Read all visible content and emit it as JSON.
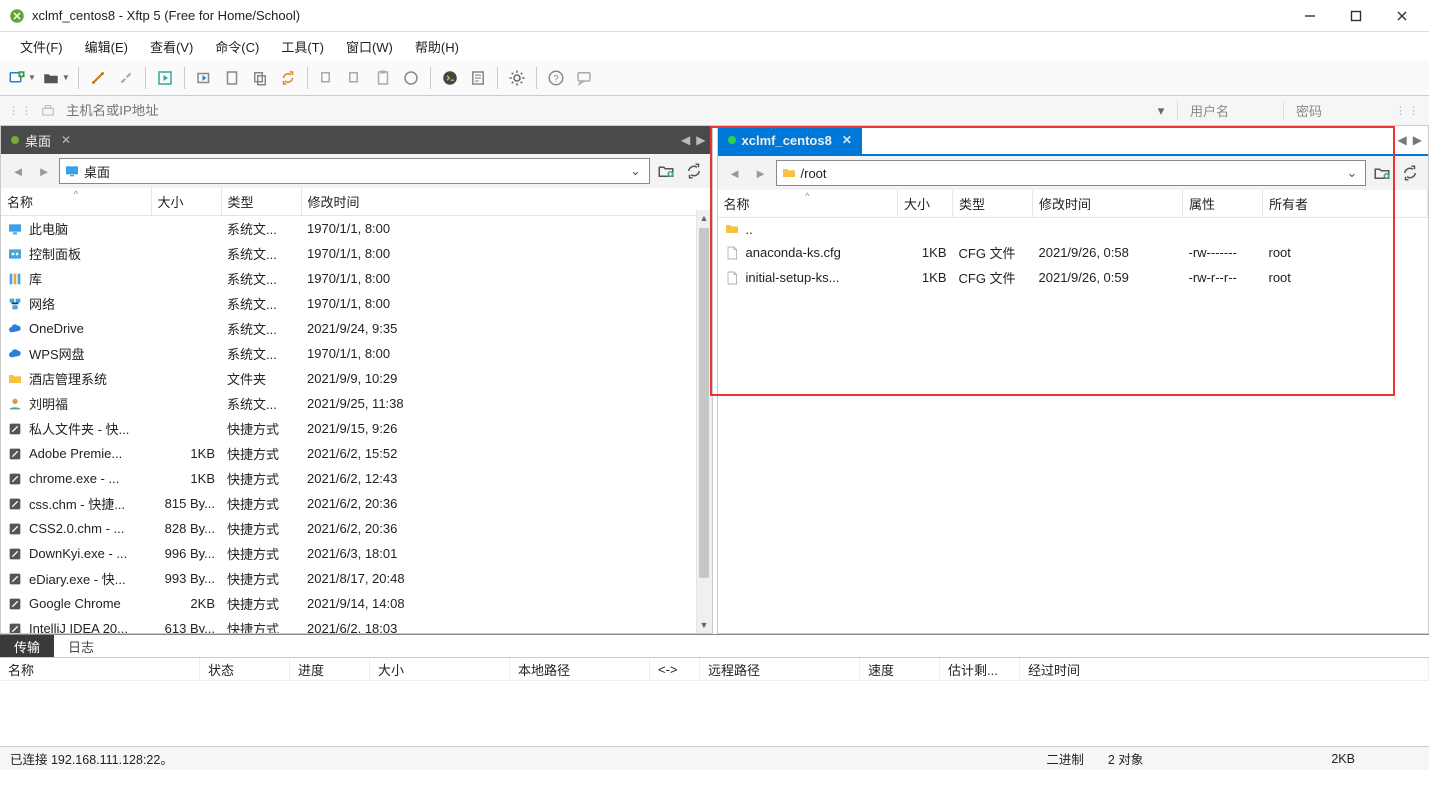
{
  "title": "xclmf_centos8   - Xftp 5 (Free for Home/School)",
  "menu": [
    "文件(F)",
    "编辑(E)",
    "查看(V)",
    "命令(C)",
    "工具(T)",
    "窗口(W)",
    "帮助(H)"
  ],
  "hostbar": {
    "placeholder": "主机名或IP地址",
    "user_ph": "用户名",
    "pass_ph": "密码"
  },
  "local": {
    "tab_label": "桌面",
    "path": "桌面",
    "cols": {
      "name": "名称",
      "size": "大小",
      "type": "类型",
      "mtime": "修改时间"
    },
    "rows": [
      {
        "icon": "pc",
        "name": "此电脑",
        "size": "",
        "type": "系统文...",
        "mtime": "1970/1/1, 8:00"
      },
      {
        "icon": "panel",
        "name": "控制面板",
        "size": "",
        "type": "系统文...",
        "mtime": "1970/1/1, 8:00"
      },
      {
        "icon": "lib",
        "name": "库",
        "size": "",
        "type": "系统文...",
        "mtime": "1970/1/1, 8:00"
      },
      {
        "icon": "net",
        "name": "网络",
        "size": "",
        "type": "系统文...",
        "mtime": "1970/1/1, 8:00"
      },
      {
        "icon": "cloud",
        "name": "OneDrive",
        "size": "",
        "type": "系统文...",
        "mtime": "2021/9/24, 9:35"
      },
      {
        "icon": "cloud",
        "name": "WPS网盘",
        "size": "",
        "type": "系统文...",
        "mtime": "1970/1/1, 8:00"
      },
      {
        "icon": "folder",
        "name": "酒店管理系统",
        "size": "",
        "type": "文件夹",
        "mtime": "2021/9/9, 10:29"
      },
      {
        "icon": "user",
        "name": "刘明福",
        "size": "",
        "type": "系统文...",
        "mtime": "2021/9/25, 11:38"
      },
      {
        "icon": "shortcut",
        "name": "私人文件夹 - 快...",
        "size": "",
        "type": "快捷方式",
        "mtime": "2021/9/15, 9:26"
      },
      {
        "icon": "app",
        "name": "Adobe Premie...",
        "size": "1KB",
        "type": "快捷方式",
        "mtime": "2021/6/2, 15:52"
      },
      {
        "icon": "app",
        "name": "chrome.exe - ...",
        "size": "1KB",
        "type": "快捷方式",
        "mtime": "2021/6/2, 12:43"
      },
      {
        "icon": "app",
        "name": "css.chm - 快捷...",
        "size": "815 By...",
        "type": "快捷方式",
        "mtime": "2021/6/2, 20:36"
      },
      {
        "icon": "app",
        "name": "CSS2.0.chm - ...",
        "size": "828 By...",
        "type": "快捷方式",
        "mtime": "2021/6/2, 20:36"
      },
      {
        "icon": "app",
        "name": "DownKyi.exe - ...",
        "size": "996 By...",
        "type": "快捷方式",
        "mtime": "2021/6/3, 18:01"
      },
      {
        "icon": "app",
        "name": "eDiary.exe - 快...",
        "size": "993 By...",
        "type": "快捷方式",
        "mtime": "2021/8/17, 20:48"
      },
      {
        "icon": "app",
        "name": "Google Chrome",
        "size": "2KB",
        "type": "快捷方式",
        "mtime": "2021/9/14, 14:08"
      },
      {
        "icon": "app",
        "name": "IntelliJ IDEA 20...",
        "size": "613 By...",
        "type": "快捷方式",
        "mtime": "2021/6/2, 18:03"
      }
    ]
  },
  "remote": {
    "tab_label": "xclmf_centos8",
    "path": "/root",
    "cols": {
      "name": "名称",
      "size": "大小",
      "type": "类型",
      "mtime": "修改时间",
      "perm": "属性",
      "owner": "所有者"
    },
    "rows": [
      {
        "icon": "folder",
        "name": "..",
        "size": "",
        "type": "",
        "mtime": "",
        "perm": "",
        "owner": ""
      },
      {
        "icon": "file",
        "name": "anaconda-ks.cfg",
        "size": "1KB",
        "type": "CFG 文件",
        "mtime": "2021/9/26, 0:58",
        "perm": "-rw-------",
        "owner": "root"
      },
      {
        "icon": "file",
        "name": "initial-setup-ks...",
        "size": "1KB",
        "type": "CFG 文件",
        "mtime": "2021/9/26, 0:59",
        "perm": "-rw-r--r--",
        "owner": "root"
      }
    ]
  },
  "transfer": {
    "tabs": {
      "transfer": "传输",
      "log": "日志"
    },
    "cols": [
      "名称",
      "状态",
      "进度",
      "大小",
      "本地路径",
      "<->",
      "远程路径",
      "速度",
      "估计剩...",
      "经过时间"
    ]
  },
  "status": {
    "conn": "已连接 192.168.111.128:22。",
    "mode": "二进制",
    "objs": "2 对象",
    "size": "2KB"
  }
}
